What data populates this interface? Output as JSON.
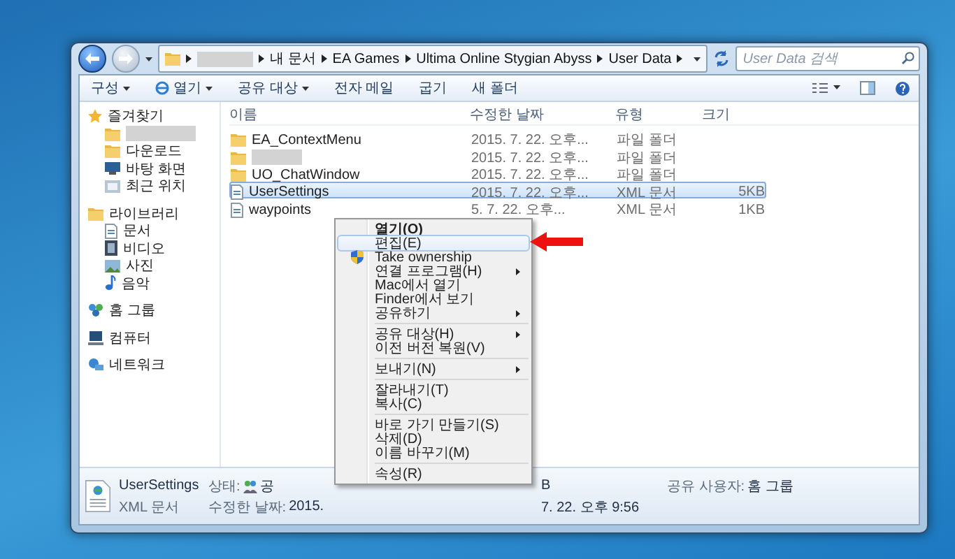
{
  "address": {
    "crumbs": [
      {
        "kind": "redacted"
      },
      {
        "kind": "text",
        "label": "내 문서"
      },
      {
        "kind": "text",
        "label": "EA Games"
      },
      {
        "kind": "text",
        "label": "Ultima Online Stygian Abyss"
      },
      {
        "kind": "text",
        "label": "User Data"
      }
    ],
    "search_placeholder": "User Data 검색"
  },
  "toolbar": [
    {
      "label": "구성",
      "menu": true,
      "has_icon": false
    },
    {
      "label": "열기",
      "menu": true,
      "has_icon": true
    },
    {
      "label": "공유 대상",
      "menu": true,
      "has_icon": false
    },
    {
      "label": "전자 메일",
      "menu": false,
      "has_icon": false
    },
    {
      "label": "굽기",
      "menu": false,
      "has_icon": false
    },
    {
      "label": "새 폴더",
      "menu": false,
      "has_icon": false
    }
  ],
  "sidebar": [
    {
      "label": "즐겨찾기",
      "kind": "favorites",
      "children": [
        {
          "kind": "redacted"
        },
        {
          "kind": "downloads",
          "label": "다운로드"
        },
        {
          "kind": "desktop",
          "label": "바탕 화면"
        },
        {
          "kind": "recent",
          "label": "최근 위치"
        }
      ]
    },
    {
      "label": "라이브러리",
      "kind": "libraries",
      "children": [
        {
          "kind": "documents",
          "label": "문서"
        },
        {
          "kind": "videos",
          "label": "비디오"
        },
        {
          "kind": "pictures",
          "label": "사진"
        },
        {
          "kind": "music",
          "label": "음악"
        }
      ]
    },
    {
      "label": "홈 그룹",
      "kind": "homegroup"
    },
    {
      "label": "컴퓨터",
      "kind": "computer"
    },
    {
      "label": "네트워크",
      "kind": "network"
    }
  ],
  "table": {
    "columns": [
      "이름",
      "수정한 날짜",
      "유형",
      "크기"
    ],
    "rows": [
      {
        "kind": "folder",
        "name": "EA_ContextMenu",
        "modified": "2015. 7. 22. 오후...",
        "type": "파일 폴더",
        "selected": false
      },
      {
        "kind": "folder",
        "redacted": true,
        "modified": "2015. 7. 22. 오후...",
        "type": "파일 폴더",
        "selected": false
      },
      {
        "kind": "folder",
        "name": "UO_ChatWindow",
        "modified": "2015. 7. 22. 오후...",
        "type": "파일 폴더",
        "selected": false
      },
      {
        "kind": "xml",
        "name": "UserSettings",
        "modified": "2015. 7. 22. 오후...",
        "type": "XML 문서",
        "size": "5KB",
        "selected": true
      },
      {
        "kind": "xml",
        "name": "waypoints",
        "modified": "5. 7. 22. 오후...",
        "type": "XML 문서",
        "size": "1KB",
        "selected": false
      }
    ]
  },
  "context_menu": [
    {
      "kind": "item",
      "label": "열기(O)",
      "default": true,
      "selected": false,
      "submenu": false
    },
    {
      "kind": "item",
      "label": "편집(E)",
      "default": false,
      "selected": true,
      "submenu": false
    },
    {
      "kind": "item",
      "label": "Take ownership",
      "default": false,
      "selected": false,
      "submenu": false,
      "has_icon": true
    },
    {
      "kind": "item",
      "label": "연결 프로그램(H)",
      "default": false,
      "selected": false,
      "submenu": true
    },
    {
      "kind": "item",
      "label": "Mac에서 열기",
      "default": false,
      "selected": false,
      "submenu": false
    },
    {
      "kind": "item",
      "label": "Finder에서 보기",
      "default": false,
      "selected": false,
      "submenu": false
    },
    {
      "kind": "item",
      "label": "공유하기",
      "default": false,
      "selected": false,
      "submenu": true
    },
    {
      "kind": "separator"
    },
    {
      "kind": "item",
      "label": "공유 대상(H)",
      "default": false,
      "selected": false,
      "submenu": true
    },
    {
      "kind": "item",
      "label": "이전 버전 복원(V)",
      "default": false,
      "selected": false,
      "submenu": false
    },
    {
      "kind": "separator"
    },
    {
      "kind": "item",
      "label": "보내기(N)",
      "default": false,
      "selected": false,
      "submenu": true
    },
    {
      "kind": "separator"
    },
    {
      "kind": "item",
      "label": "잘라내기(T)",
      "default": false,
      "selected": false,
      "submenu": false
    },
    {
      "kind": "item",
      "label": "복사(C)",
      "default": false,
      "selected": false,
      "submenu": false
    },
    {
      "kind": "separator"
    },
    {
      "kind": "item",
      "label": "바로 가기 만들기(S)",
      "default": false,
      "selected": false,
      "submenu": false
    },
    {
      "kind": "item",
      "label": "삭제(D)",
      "default": false,
      "selected": false,
      "submenu": false
    },
    {
      "kind": "item",
      "label": "이름 바꾸기(M)",
      "default": false,
      "selected": false,
      "submenu": false
    },
    {
      "kind": "separator"
    },
    {
      "kind": "item",
      "label": "속성(R)",
      "default": false,
      "selected": false,
      "submenu": false
    }
  ],
  "details": {
    "name": "UserSettings",
    "type": "XML 문서",
    "status_label": "상태:",
    "status_value": "공",
    "status_tail": "B",
    "modified_label": "수정한 날짜:",
    "modified_value": "2015.",
    "modified_tail": "7. 22. 오후 9:56",
    "shared_label": "공유 사용자:",
    "shared_value": "홈 그룹"
  }
}
